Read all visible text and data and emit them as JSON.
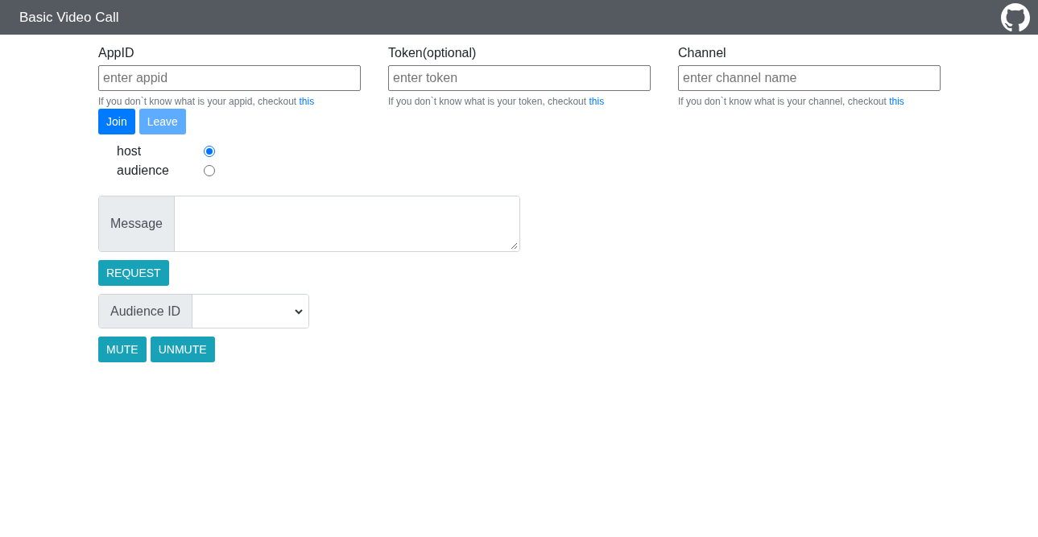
{
  "header": {
    "title": "Basic Video Call"
  },
  "fields": [
    {
      "label": "AppID",
      "placeholder": "enter appid",
      "help": "If you don`t know what is your appid, checkout",
      "link": "this"
    },
    {
      "label": "Token(optional)",
      "placeholder": "enter token",
      "help": "If you don`t know what is your token, checkout",
      "link": "this"
    },
    {
      "label": "Channel",
      "placeholder": "enter channel name",
      "help": "If you don`t know what is your channel, checkout",
      "link": "this"
    }
  ],
  "actions": [
    {
      "label": "Join",
      "disabled": false
    },
    {
      "label": "Leave",
      "disabled": true
    }
  ],
  "roles": [
    {
      "label": "host",
      "selected": true
    },
    {
      "label": "audience",
      "selected": false
    }
  ],
  "message": {
    "label": "Message"
  },
  "request_button": "REQUEST",
  "audience": {
    "label": "Audience ID"
  },
  "audio_buttons": [
    "MUTE",
    "UNMUTE"
  ]
}
